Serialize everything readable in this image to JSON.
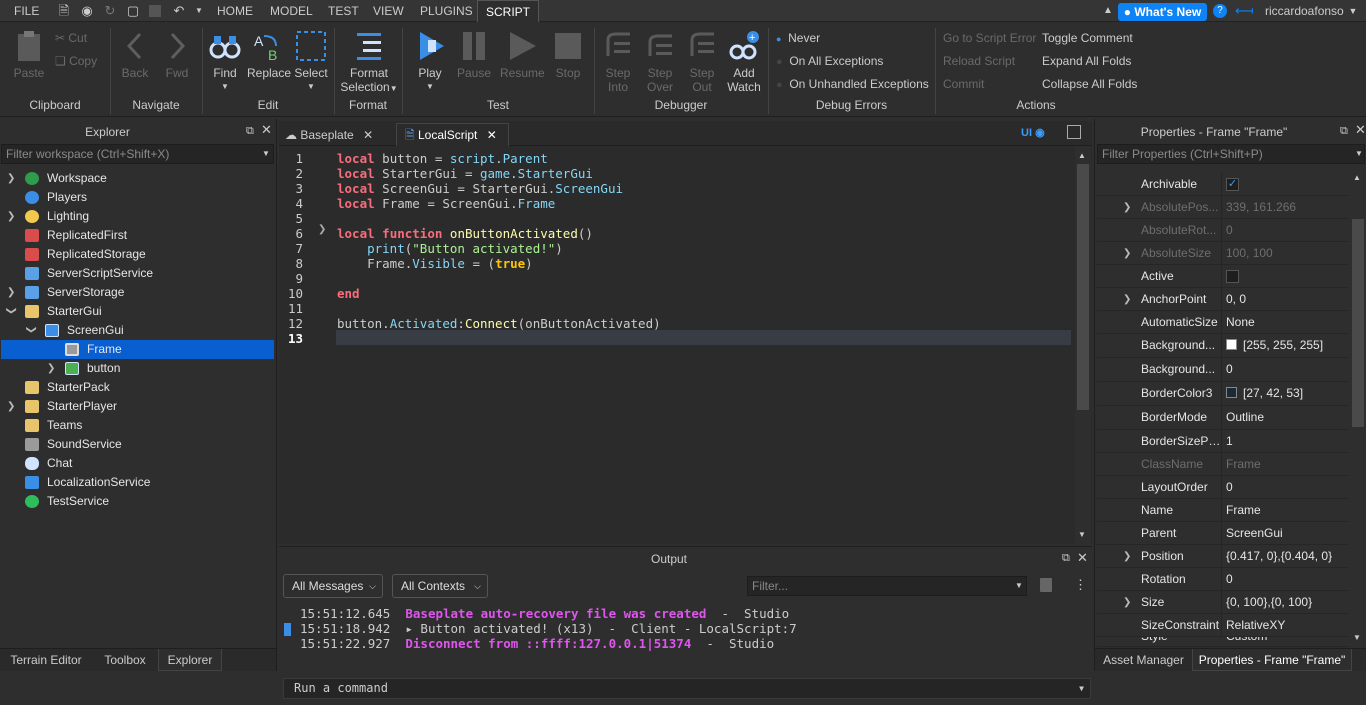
{
  "menubar": {
    "file": "FILE",
    "tabs": [
      "HOME",
      "MODEL",
      "TEST",
      "VIEW",
      "PLUGINS",
      "SCRIPT"
    ],
    "whats_new": "What's New",
    "username": "riccardoafonso"
  },
  "ribbon": {
    "clipboard": {
      "paste": "Paste",
      "cut": "Cut",
      "copy": "Copy",
      "label": "Clipboard"
    },
    "navigate": {
      "back": "Back",
      "fwd": "Fwd",
      "label": "Navigate"
    },
    "edit": {
      "find": "Find",
      "replace": "Replace",
      "select": "Select",
      "label": "Edit"
    },
    "format": {
      "format_selection_1": "Format",
      "format_selection_2": "Selection",
      "label": "Format"
    },
    "test": {
      "play": "Play",
      "pause": "Pause",
      "resume": "Resume",
      "stop": "Stop",
      "label": "Test"
    },
    "debugger": {
      "step_into_1": "Step",
      "step_into_2": "Into",
      "step_over_1": "Step",
      "step_over_2": "Over",
      "step_out_1": "Step",
      "step_out_2": "Out",
      "add_watch_1": "Add",
      "add_watch_2": "Watch",
      "label": "Debugger"
    },
    "debug_errors": {
      "never": "Never",
      "all": "On All Exceptions",
      "unhandled": "On Unhandled Exceptions",
      "label": "Debug Errors"
    },
    "actions": {
      "goto_error": "Go to Script Error",
      "reload": "Reload Script",
      "commit": "Commit",
      "toggle_comment": "Toggle Comment",
      "expand": "Expand All Folds",
      "collapse": "Collapse All Folds",
      "label": "Actions"
    }
  },
  "explorer": {
    "title": "Explorer",
    "filter": "Filter workspace (Ctrl+Shift+X)",
    "items": [
      "Workspace",
      "Players",
      "Lighting",
      "ReplicatedFirst",
      "ReplicatedStorage",
      "ServerScriptService",
      "ServerStorage",
      "StarterGui",
      "ScreenGui",
      "Frame",
      "button",
      "StarterPack",
      "StarterPlayer",
      "Teams",
      "SoundService",
      "Chat",
      "LocalizationService",
      "TestService"
    ],
    "bottom_tabs": [
      "Terrain Editor",
      "Toolbox",
      "Explorer"
    ]
  },
  "editor": {
    "tabs": [
      "Baseplate",
      "LocalScript"
    ],
    "ui_badge": "UI",
    "line_numbers": [
      "1",
      "2",
      "3",
      "4",
      "5",
      "6",
      "7",
      "8",
      "9",
      "10",
      "11",
      "12",
      "13"
    ]
  },
  "output": {
    "title": "Output",
    "all_messages": "All Messages",
    "all_contexts": "All Contexts",
    "filter": "Filter...",
    "lines": [
      {
        "time": "15:51:12.645",
        "text": "Baseplate auto-recovery file was created",
        "source": "  -  Studio"
      },
      {
        "time": "15:51:18.942",
        "text": " ▸ Button activated! (x13)  -  Client - LocalScript:7",
        "source": ""
      },
      {
        "time": "15:51:22.927",
        "text": "Disconnect from ::ffff:127.0.0.1|51374",
        "source": "  -  Studio"
      }
    ],
    "command_placeholder": "Run a command"
  },
  "properties": {
    "title": "Properties - Frame \"Frame\"",
    "filter": "Filter Properties (Ctrl+Shift+P)",
    "rows": [
      {
        "name": "Archivable",
        "value": ""
      },
      {
        "name": "AbsolutePos...",
        "value": "339, 161.266"
      },
      {
        "name": "AbsoluteRot...",
        "value": "0"
      },
      {
        "name": "AbsoluteSize",
        "value": "100, 100"
      },
      {
        "name": "Active",
        "value": ""
      },
      {
        "name": "AnchorPoint",
        "value": "0, 0"
      },
      {
        "name": "AutomaticSize",
        "value": "None"
      },
      {
        "name": "Background...",
        "value": "[255, 255, 255]"
      },
      {
        "name": "Background...",
        "value": "0"
      },
      {
        "name": "BorderColor3",
        "value": "[27, 42, 53]"
      },
      {
        "name": "BorderMode",
        "value": "Outline"
      },
      {
        "name": "BorderSizePi...",
        "value": "1"
      },
      {
        "name": "ClassName",
        "value": "Frame"
      },
      {
        "name": "LayoutOrder",
        "value": "0"
      },
      {
        "name": "Name",
        "value": "Frame"
      },
      {
        "name": "Parent",
        "value": "ScreenGui"
      },
      {
        "name": "Position",
        "value": "{0.417, 0},{0.404, 0}"
      },
      {
        "name": "Rotation",
        "value": "0"
      },
      {
        "name": "Size",
        "value": "{0, 100},{0, 100}"
      },
      {
        "name": "SizeConstraint",
        "value": "RelativeXY"
      },
      {
        "name": "Style",
        "value": "Custom"
      }
    ],
    "bottom_tabs": [
      "Asset Manager",
      "Properties - Frame \"Frame\""
    ]
  },
  "colors": {
    "accent": "#0d83f5",
    "selection": "#0a5fd0",
    "panel": "#2e2e2e",
    "editor": "#2b2b2b"
  }
}
